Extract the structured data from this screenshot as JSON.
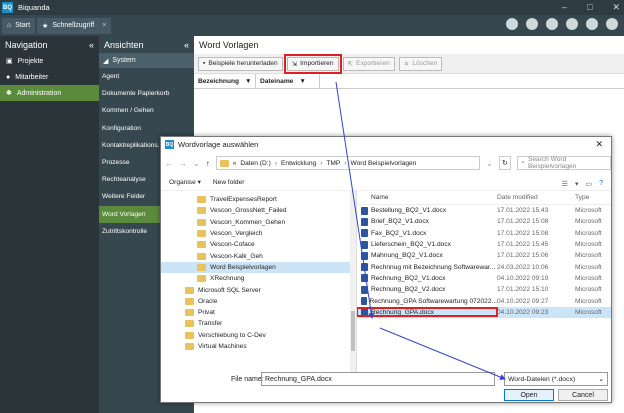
{
  "app": {
    "title": "Biquanda",
    "logo": "BQ"
  },
  "toolbar": {
    "start_label": "Start",
    "favorites_label": "Schnellzugriff",
    "close_glyph": "×"
  },
  "navigation": {
    "title": "Navigation",
    "collapse": "«",
    "items": [
      {
        "label": "Projekte",
        "icon": "folder-icon"
      },
      {
        "label": "Mitarbeiter",
        "icon": "person-icon"
      },
      {
        "label": "Administration",
        "icon": "gear-icon",
        "active": true
      }
    ]
  },
  "ansichten": {
    "title": "Ansichten",
    "collapse": "«",
    "section": "System",
    "items": [
      "Agent",
      "Dokumente Papierkorb",
      "Kommen / Gehen",
      "Konfiguration",
      "Kontaktreplikations...",
      "Prozesse",
      "Rechteanalyse",
      "Weitere Felder",
      "Word Vorlagen",
      "Zutrittskontrolle"
    ],
    "active_index": 8
  },
  "main": {
    "title": "Word Vorlagen",
    "buttons": {
      "download": "Beispiele herunterladen",
      "import": "Importieren",
      "export": "Exportieren",
      "delete": "Löschen"
    },
    "columns": [
      "Bezeichnung",
      "Dateiname"
    ]
  },
  "dialog": {
    "title": "Wordvorlage auswählen",
    "path": [
      "Daten (D:)",
      "Entwicklung",
      "TMP",
      "Word Beispielvorlagen"
    ],
    "path_prefix": "«",
    "search_placeholder": "Suchen: Word Beispielvorlagen",
    "search_display": "Search Word Beispielvorlagen",
    "organise": "Organise ▾",
    "new_folder": "New folder",
    "tree": [
      {
        "label": "TravelExpensesReport",
        "indent": 1
      },
      {
        "label": "Vescon_GrossNett_Failed",
        "indent": 1
      },
      {
        "label": "Vescon_Kommen_Gehen",
        "indent": 1
      },
      {
        "label": "Vescon_Vergleich",
        "indent": 1
      },
      {
        "label": "Vescon-Coface",
        "indent": 1
      },
      {
        "label": "Vescon-Kalk_Geh",
        "indent": 1
      },
      {
        "label": "Word Beispielvorlagen",
        "indent": 1,
        "selected": true
      },
      {
        "label": "XRechnung",
        "indent": 1
      },
      {
        "label": "Microsoft SQL Server",
        "indent": 0
      },
      {
        "label": "Oracle",
        "indent": 0
      },
      {
        "label": "Privat",
        "indent": 0
      },
      {
        "label": "Transfer",
        "indent": 0
      },
      {
        "label": "Verschiebung to C-Dev",
        "indent": 0
      },
      {
        "label": "Virtual Machines",
        "indent": 0
      }
    ],
    "file_columns": {
      "name": "Name",
      "date": "Date modified",
      "type": "Type"
    },
    "files": [
      {
        "name": "Bestellung_BQ2_V1.docx",
        "date": "17.01.2022 15:43",
        "type": "Microsoft"
      },
      {
        "name": "Brief_BQ2_V1.docx",
        "date": "17.01.2022 15:08",
        "type": "Microsoft"
      },
      {
        "name": "Fax_BQ2_V1.docx",
        "date": "17.01.2022 15:08",
        "type": "Microsoft"
      },
      {
        "name": "Lieferschein_BQ2_V1.docx",
        "date": "17.01.2022 15:45",
        "type": "Microsoft"
      },
      {
        "name": "Mahnung_BQ2_V1.docx",
        "date": "17.01.2022 15:06",
        "type": "Microsoft"
      },
      {
        "name": "Rechnnug mit Bezeichnung Softwarewar...",
        "date": "24.03.2022 10:06",
        "type": "Microsoft"
      },
      {
        "name": "Rechnung_BQ2_V1.docx",
        "date": "04.10.2022 09:19",
        "type": "Microsoft"
      },
      {
        "name": "Rechnung_BQ2_V2.docx",
        "date": "17.01.2022 15:10",
        "type": "Microsoft"
      },
      {
        "name": "Rechnung_GPA Softwarewartung 072022...",
        "date": "04.10.2022 09:27",
        "type": "Microsoft"
      },
      {
        "name": "Rechnung_GPA.docx",
        "date": "04.10.2022 09:23",
        "type": "Microsoft",
        "selected": true
      }
    ],
    "file_name_label": "File name:",
    "file_name_value": "Rechnung_GPA.docx",
    "file_type": "Word-Dateien (*.docx)",
    "open_label": "Open",
    "cancel_label": "Cancel"
  },
  "colors": {
    "accent_green": "#5b8a3c",
    "dark": "#2a3439",
    "highlight_red": "#e02020",
    "annotation_blue": "#3344cc"
  }
}
